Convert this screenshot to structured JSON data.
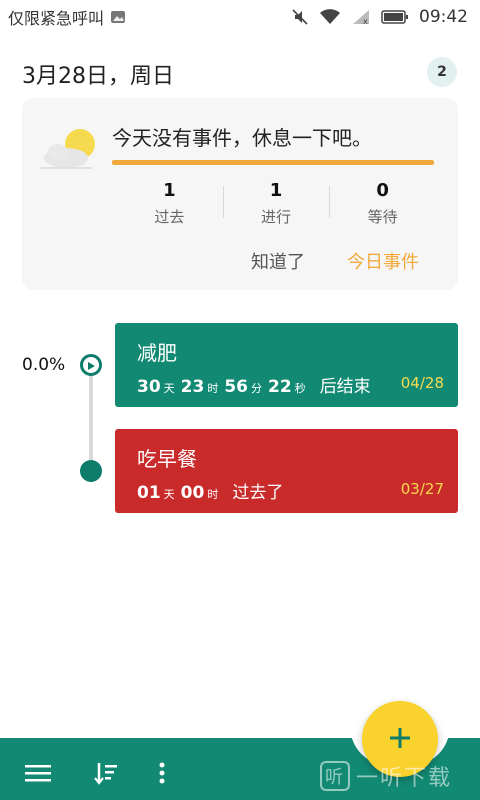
{
  "status_bar": {
    "carrier_text": "仅限紧急呼叫",
    "time": "09:42"
  },
  "header": {
    "date": "3月28日，周日",
    "badge_count": "2"
  },
  "summary": {
    "message": "今天没有事件，休息一下吧。",
    "stats": [
      {
        "value": "1",
        "label": "过去"
      },
      {
        "value": "1",
        "label": "进行"
      },
      {
        "value": "0",
        "label": "等待"
      }
    ],
    "ok_label": "知道了",
    "today_label": "今日事件",
    "accent_color": "#f2a93b"
  },
  "timeline": {
    "progress": "0.0%",
    "events": [
      {
        "title": "减肥",
        "days": "30",
        "days_unit": "天",
        "hours": "23",
        "hours_unit": "时",
        "minutes": "56",
        "minutes_unit": "分",
        "seconds": "22",
        "seconds_unit": "秒",
        "suffix": "后结束",
        "date": "04/28",
        "color": "#128a73"
      },
      {
        "title": "吃早餐",
        "days": "01",
        "days_unit": "天",
        "hours": "00",
        "hours_unit": "时",
        "suffix": "过去了",
        "date": "03/27",
        "color": "#c92b2b"
      }
    ]
  },
  "fab": {
    "icon": "plus-icon",
    "color": "#f9d22e"
  },
  "bottom_bar": {
    "icons": [
      "menu-icon",
      "sort-icon",
      "more-vert-icon"
    ],
    "color": "#128a73"
  },
  "watermark": {
    "mark": "听",
    "text": "一听下载"
  }
}
